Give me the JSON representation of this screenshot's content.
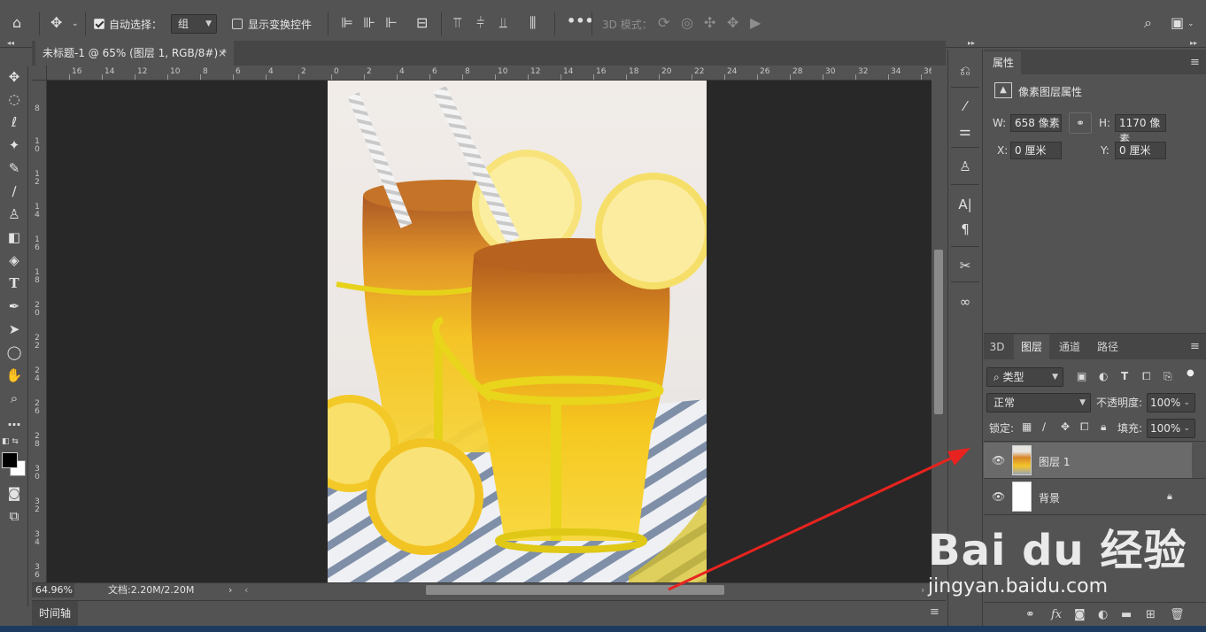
{
  "options_bar": {
    "auto_select_label": "自动选择：",
    "auto_select_checked": true,
    "auto_select_value": "组",
    "show_transform_label": "显示变换控件",
    "show_transform_checked": false,
    "mode3d_label": "3D 模式："
  },
  "document": {
    "tab_title": "未标题-1 @ 65% (图层 1, RGB/8#) *",
    "close_glyph": "×",
    "zoom": "64.96%",
    "doc_size": "文档:2.20M/2.20M"
  },
  "rulers": {
    "horizontal": [
      "16",
      "14",
      "12",
      "10",
      "8",
      "6",
      "4",
      "2",
      "0",
      "2",
      "4",
      "6",
      "8",
      "10",
      "12",
      "14",
      "16",
      "18",
      "20",
      "22",
      "24",
      "26",
      "28",
      "30",
      "32",
      "34",
      "36"
    ],
    "vertical": [
      "8",
      "1\n0",
      "1\n2",
      "1\n4",
      "1\n6",
      "1\n8",
      "2\n0",
      "2\n2",
      "2\n4",
      "2\n6",
      "2\n8",
      "3\n0",
      "3\n2",
      "3\n4",
      "3\n6"
    ]
  },
  "timeline": {
    "tab": "时间轴"
  },
  "properties": {
    "tab": "属性",
    "header": "像素图层属性",
    "w_label": "W:",
    "w_value": "658 像素",
    "h_label": "H:",
    "h_value": "1170 像素",
    "x_label": "X:",
    "x_value": "0 厘米",
    "y_label": "Y:",
    "y_value": "0 厘米"
  },
  "layers_panel": {
    "tabs": [
      "3D",
      "图层",
      "通道",
      "路径"
    ],
    "active_tab": 1,
    "filter_value": "类型",
    "blend_mode": "正常",
    "opacity_label": "不透明度:",
    "opacity_value": "100%",
    "lock_label": "锁定:",
    "fill_label": "填充:",
    "fill_value": "100%",
    "layers": [
      {
        "name": "图层 1",
        "selected": true
      },
      {
        "name": "背景",
        "selected": false,
        "locked": true
      }
    ]
  },
  "watermark": {
    "brand": "Bai du 经验",
    "url": "jingyan.baidu.com"
  },
  "colors": {
    "workspace_bg": "#535353",
    "canvas_bg": "#282828",
    "panel_dark": "#464646",
    "selected_layer": "#6a6a6a",
    "annotation_arrow": "#e8231f"
  }
}
